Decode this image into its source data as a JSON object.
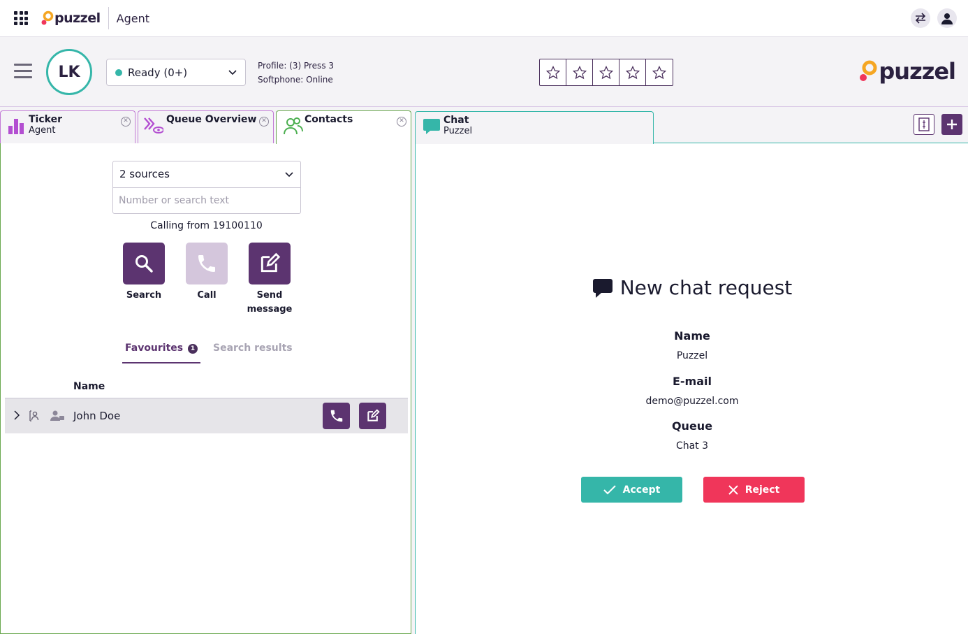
{
  "topbar": {
    "brand": "puzzel",
    "app_name": "Agent"
  },
  "header": {
    "avatar_initials": "LK",
    "status": {
      "label": "Ready (0+)",
      "color": "#35b6a9"
    },
    "profile_text": "Profile: (3) Press 3",
    "softphone_text": "Softphone: Online",
    "rating_count": 5,
    "brand": "puzzel"
  },
  "tabs": [
    {
      "title": "Ticker",
      "subtitle": "Agent",
      "icon": "bar-chart-icon"
    },
    {
      "title": "Queue Overview",
      "subtitle": "",
      "icon": "queue-overview-icon"
    },
    {
      "title": "Contacts",
      "subtitle": "",
      "icon": "contacts-icon"
    }
  ],
  "contacts": {
    "sources_label": "2 sources",
    "search_placeholder": "Number or search text",
    "calling_from": "Calling from 19100110",
    "actions": [
      {
        "label": "Search",
        "icon": "search-icon",
        "enabled": true
      },
      {
        "label": "Call",
        "icon": "phone-icon",
        "enabled": false
      },
      {
        "label": "Send message",
        "icon": "compose-icon",
        "enabled": true
      }
    ],
    "subtabs": {
      "favourites": "Favourites",
      "favourites_count": "1",
      "search_results": "Search results"
    },
    "column_name": "Name",
    "rows": [
      {
        "name": "John Doe"
      }
    ]
  },
  "chat": {
    "tab_title": "Chat",
    "tab_subtitle": "Puzzel",
    "request_title": "New chat request",
    "fields": [
      {
        "label": "Name",
        "value": "Puzzel"
      },
      {
        "label": "E-mail",
        "value": "demo@puzzel.com"
      },
      {
        "label": "Queue",
        "value": "Chat 3"
      }
    ],
    "accept_label": "Accept",
    "reject_label": "Reject"
  },
  "colors": {
    "primary": "#5c3470",
    "teal": "#35b6a9",
    "reject": "#f0365a"
  }
}
